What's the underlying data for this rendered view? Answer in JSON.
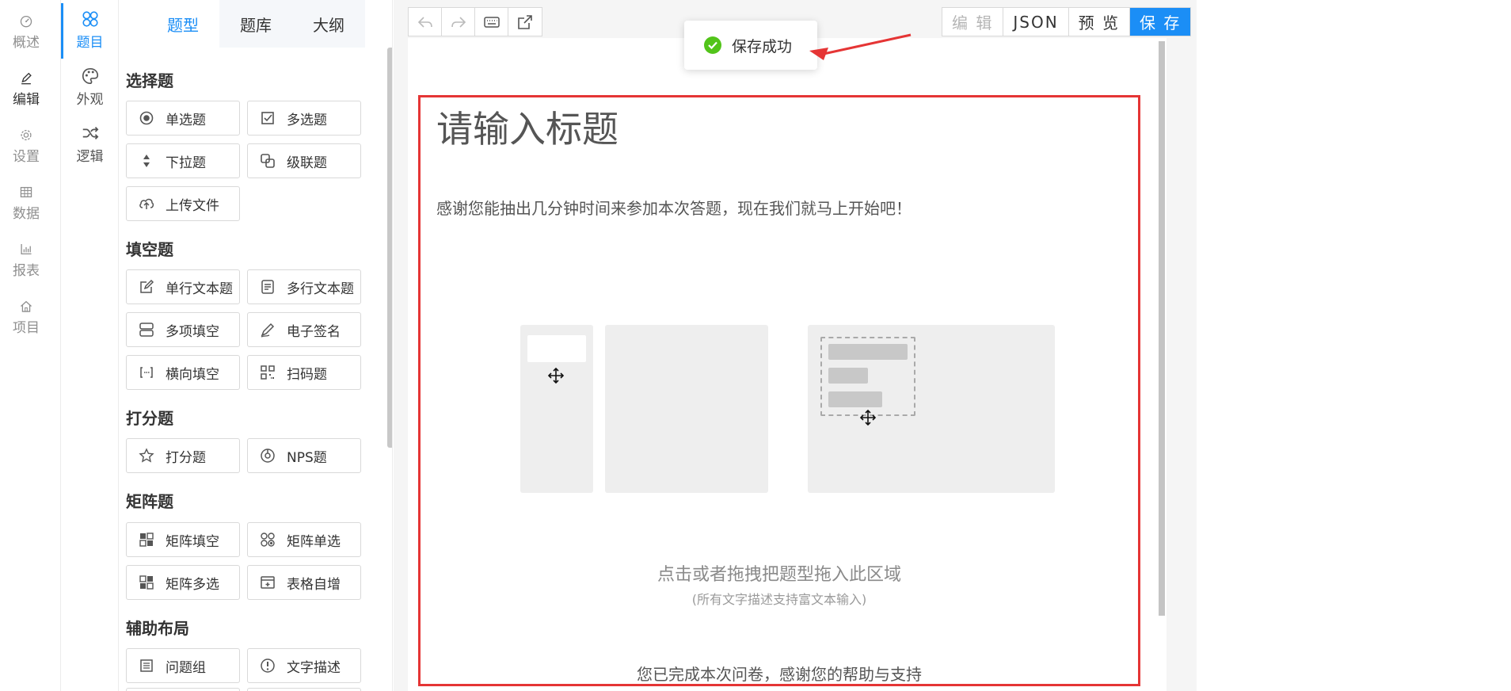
{
  "rail": {
    "items": [
      {
        "label": "概述",
        "icon": "dashboard-icon"
      },
      {
        "label": "编辑",
        "icon": "pen-icon"
      },
      {
        "label": "设置",
        "icon": "gear-icon"
      },
      {
        "label": "数据",
        "icon": "table-icon"
      },
      {
        "label": "报表",
        "icon": "bar-chart-icon"
      },
      {
        "label": "项目",
        "icon": "home-icon"
      }
    ]
  },
  "subnav": {
    "items": [
      {
        "label": "题目",
        "icon": "question-types-icon"
      },
      {
        "label": "外观",
        "icon": "palette-icon"
      },
      {
        "label": "逻辑",
        "icon": "shuffle-icon"
      }
    ]
  },
  "panel": {
    "tabs": [
      "题型",
      "题库",
      "大纲"
    ],
    "groups": {
      "choice": {
        "title": "选择题",
        "items": [
          "单选题",
          "多选题",
          "下拉题",
          "级联题",
          "上传文件"
        ]
      },
      "fill": {
        "title": "填空题",
        "items": [
          "单行文本题",
          "多行文本题",
          "多项填空",
          "电子签名",
          "横向填空",
          "扫码题"
        ]
      },
      "score": {
        "title": "打分题",
        "items": [
          "打分题",
          "NPS题"
        ]
      },
      "matrix": {
        "title": "矩阵题",
        "items": [
          "矩阵填空",
          "矩阵单选",
          "矩阵多选",
          "表格自增"
        ]
      },
      "layout": {
        "title": "辅助布局",
        "items": [
          "问题组",
          "文字描述"
        ]
      }
    }
  },
  "toolbar": {
    "undo": "undo-icon",
    "redo": "redo-icon",
    "keyboard": "keyboard-icon",
    "export": "export-icon"
  },
  "actions": {
    "edit": "编 辑",
    "json": "JSON",
    "preview": "预 览",
    "save": "保 存"
  },
  "toast": {
    "message": "保存成功"
  },
  "survey": {
    "title": "请输入标题",
    "description": "感谢您能抽出几分钟时间来参加本次答题，现在我们就马上开始吧！",
    "drop_hint": "点击或者拖拽把题型拖入此区域",
    "drop_sub": "(所有文字描述支持富文本输入)",
    "end_text": "您已完成本次问卷，感谢您的帮助与支持"
  },
  "colors": {
    "primary": "#1b8ef6",
    "highlight_border": "#e53535",
    "success": "#52c41a"
  }
}
